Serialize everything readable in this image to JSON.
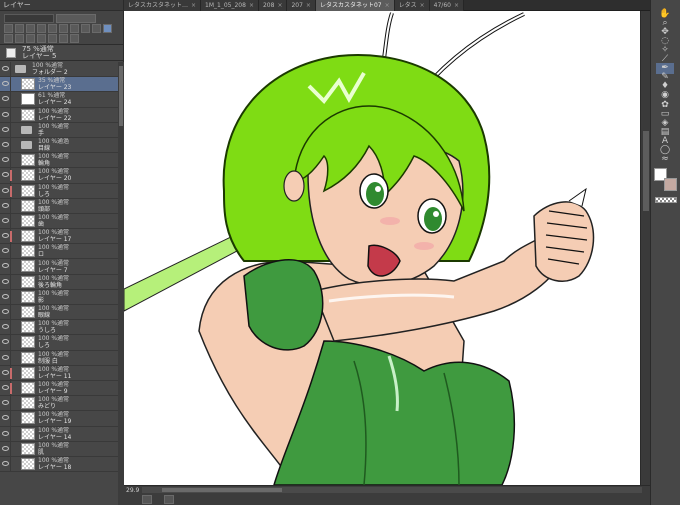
{
  "layer_panel": {
    "header": "レイヤー",
    "current": {
      "opacity_mode": "75 %通常",
      "name": "レイヤー 5"
    },
    "layers": [
      {
        "indent": 0,
        "type": "folder",
        "mode": "100 %通常",
        "name": "フォルダー 2",
        "mark": ""
      },
      {
        "indent": 1,
        "type": "checker",
        "mode": "35 %通常",
        "name": "レイヤー 23",
        "mark": "",
        "selected": true
      },
      {
        "indent": 1,
        "type": "white",
        "mode": "61 %通常",
        "name": "レイヤー 24",
        "mark": ""
      },
      {
        "indent": 1,
        "type": "checker",
        "mode": "100 %通常",
        "name": "レイヤー 22",
        "mark": ""
      },
      {
        "indent": 1,
        "type": "folder",
        "mode": "100 %通常",
        "name": "手",
        "mark": ""
      },
      {
        "indent": 1,
        "type": "folder",
        "mode": "100 %通過",
        "name": "目線",
        "mark": ""
      },
      {
        "indent": 1,
        "type": "checker",
        "mode": "100 %通常",
        "name": "輪角",
        "mark": ""
      },
      {
        "indent": 1,
        "type": "checker",
        "mode": "100 %通常",
        "name": "レイヤー 20",
        "mark": "#c86b6b"
      },
      {
        "indent": 1,
        "type": "checker",
        "mode": "100 %通常",
        "name": "しろ",
        "mark": "#c86b6b"
      },
      {
        "indent": 1,
        "type": "checker",
        "mode": "100 %通常",
        "name": "頭部",
        "mark": ""
      },
      {
        "indent": 1,
        "type": "checker",
        "mode": "100 %通常",
        "name": "歯",
        "mark": ""
      },
      {
        "indent": 1,
        "type": "checker",
        "mode": "100 %通常",
        "name": "レイヤー 17",
        "mark": "#c86b6b"
      },
      {
        "indent": 1,
        "type": "checker",
        "mode": "100 %通常",
        "name": "ロ",
        "mark": ""
      },
      {
        "indent": 1,
        "type": "checker",
        "mode": "100 %通常",
        "name": "レイヤー 7",
        "mark": ""
      },
      {
        "indent": 1,
        "type": "checker",
        "mode": "100 %通常",
        "name": "後ろ輪角",
        "mark": ""
      },
      {
        "indent": 1,
        "type": "checker",
        "mode": "100 %通常",
        "name": "影",
        "mark": ""
      },
      {
        "indent": 1,
        "type": "checker",
        "mode": "100 %通常",
        "name": "眼線",
        "mark": ""
      },
      {
        "indent": 1,
        "type": "checker",
        "mode": "100 %通常",
        "name": "うしろ",
        "mark": ""
      },
      {
        "indent": 1,
        "type": "checker",
        "mode": "100 %通常",
        "name": "しろ",
        "mark": ""
      },
      {
        "indent": 1,
        "type": "checker",
        "mode": "100 %通常",
        "name": "制服 白",
        "mark": ""
      },
      {
        "indent": 1,
        "type": "checker",
        "mode": "100 %通常",
        "name": "レイヤー 11",
        "mark": "#c86b6b"
      },
      {
        "indent": 1,
        "type": "checker",
        "mode": "100 %通常",
        "name": "レイヤー 9",
        "mark": "#c86b6b"
      },
      {
        "indent": 1,
        "type": "checker",
        "mode": "100 %通常",
        "name": "みどり",
        "mark": ""
      },
      {
        "indent": 1,
        "type": "checker",
        "mode": "100 %通常",
        "name": "レイヤー 19",
        "mark": ""
      },
      {
        "indent": 1,
        "type": "checker",
        "mode": "100 %通常",
        "name": "レイヤー 14",
        "mark": ""
      },
      {
        "indent": 1,
        "type": "checker",
        "mode": "100 %通常",
        "name": "肌",
        "mark": ""
      },
      {
        "indent": 1,
        "type": "checker",
        "mode": "100 %通常",
        "name": "レイヤー 18",
        "mark": ""
      }
    ]
  },
  "tabs": [
    {
      "label": "レタスカスタネット…",
      "active": false
    },
    {
      "label": "1M_1_05_208",
      "active": false
    },
    {
      "label": "208",
      "active": false
    },
    {
      "label": "207",
      "active": false
    },
    {
      "label": "レタスカスタネット07",
      "active": true
    },
    {
      "label": "レタス",
      "active": false
    },
    {
      "label": "47/60",
      "active": false
    }
  ],
  "status": {
    "zoom": "29.9"
  },
  "colors": {
    "main": "#ffffff",
    "sub": "#c4a9a1",
    "accent": "#5a6e8f",
    "hair": "#7fdc14",
    "outfit": "#3f9a3f",
    "skin": "#f5cdb4"
  },
  "tools": [
    "hand-icon",
    "zoom-icon",
    "move-icon",
    "lasso-icon",
    "wand-icon",
    "eyedropper-icon",
    "pen-icon",
    "pencil-icon",
    "brush-icon",
    "airbrush-icon",
    "decoration-icon",
    "eraser-icon",
    "fill-icon",
    "gradient-icon",
    "text-icon",
    "balloon-icon",
    "blend-icon"
  ]
}
